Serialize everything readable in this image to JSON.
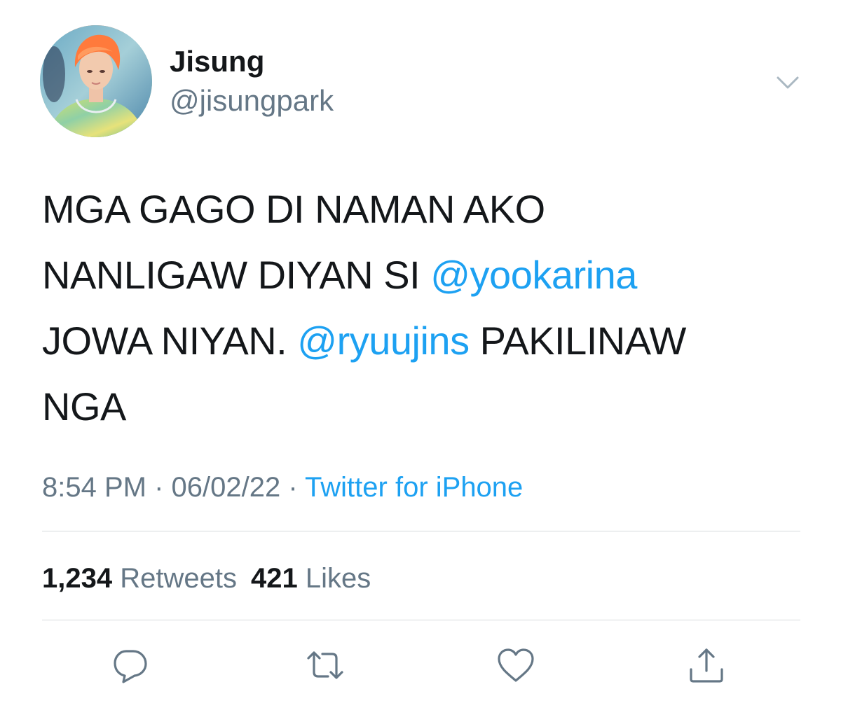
{
  "user": {
    "display_name": "Jisung",
    "handle": "@jisungpark"
  },
  "tweet": {
    "line1": "MGA GAGO DI NAMAN AKO",
    "line2_text": "NANLIGAW DIYAN SI ",
    "mention1": "@yookarina",
    "line3_text": "JOWA NIYAN. ",
    "mention2": "@ryuujins",
    "line3_tail": " PAKILINAW",
    "line4": "NGA"
  },
  "meta": {
    "time": "8:54 PM",
    "sep1": " · ",
    "date": "06/02/22",
    "sep2": " · ",
    "source": "Twitter for iPhone"
  },
  "stats": {
    "retweets_count": "1,234",
    "retweets_label": " Retweets",
    "likes_count": "421",
    "likes_label": " Likes"
  },
  "icons": {
    "more": "chevron-down-icon",
    "reply": "reply-icon",
    "retweet": "retweet-icon",
    "like": "heart-icon",
    "share": "share-icon"
  },
  "colors": {
    "mention": "#1da1f2",
    "secondary": "#657786",
    "text": "#14171a",
    "divider": "#d6dadd"
  }
}
